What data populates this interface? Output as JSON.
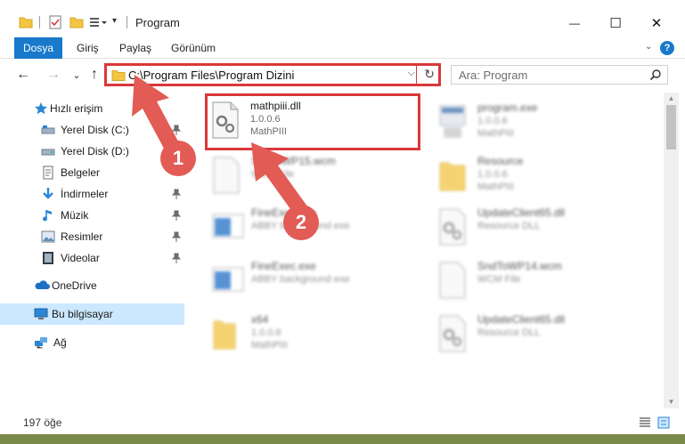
{
  "window": {
    "title": "Program",
    "minimize": "—",
    "maximize": "☐",
    "close": "✕"
  },
  "ribbon": {
    "tabs": [
      "Dosya",
      "Giriş",
      "Paylaş",
      "Görünüm"
    ],
    "help": "?"
  },
  "nav": {
    "back": "←",
    "forward": "→",
    "recent": "⌄",
    "up": "↑",
    "address": "C:\\Program Files\\Program Dizini",
    "address_dropdown": "⌵",
    "refresh": "↻",
    "search_placeholder": "Ara: Program"
  },
  "sidebar": {
    "items": [
      {
        "label": "Hızlı erişim",
        "icon": "star-icon"
      },
      {
        "label": "Yerel Disk (C:)",
        "icon": "drive-icon",
        "pinned": true
      },
      {
        "label": "Yerel Disk (D:)",
        "icon": "drive-icon"
      },
      {
        "label": "Belgeler",
        "icon": "documents-icon"
      },
      {
        "label": "İndirmeler",
        "icon": "download-icon",
        "pinned": true
      },
      {
        "label": "Müzik",
        "icon": "music-icon",
        "pinned": true
      },
      {
        "label": "Resimler",
        "icon": "pictures-icon",
        "pinned": true
      },
      {
        "label": "Videolar",
        "icon": "videos-icon",
        "pinned": true
      },
      {
        "label": "OneDrive",
        "icon": "cloud-icon"
      },
      {
        "label": "Bu bilgisayar",
        "icon": "computer-icon",
        "selected": true
      },
      {
        "label": "Ağ",
        "icon": "network-icon"
      }
    ]
  },
  "files": [
    {
      "name": "mathpiii.dll",
      "line2": "1.0.0.6",
      "line3": "MathPIII",
      "icon": "dll-gear-icon",
      "highlight": true
    },
    {
      "name": "program.exe",
      "line2": "1.0.0.6",
      "line3": "MathPIII",
      "icon": "exe-icon"
    },
    {
      "name": "SndToWP15.wcm",
      "line2": "WCM File",
      "line3": "",
      "icon": "file-icon"
    },
    {
      "name": "Resource",
      "line2": "1.0.0.6",
      "line3": "MathPIII",
      "icon": "folder-icon"
    },
    {
      "name": "FineExec.exe",
      "line2": "ABBY background exe",
      "line3": "",
      "icon": "app-window-icon"
    },
    {
      "name": "UpdateClient65.dll",
      "line2": "Resource DLL",
      "line3": "",
      "icon": "dll-gear-icon"
    },
    {
      "name": "FineExec.exe",
      "line2": "ABBY background exe",
      "line3": "",
      "icon": "app-window-icon"
    },
    {
      "name": "SndToWP14.wcm",
      "line2": "WCM File",
      "line3": "",
      "icon": "file-icon"
    },
    {
      "name": "x64",
      "line2": "1.0.0.6",
      "line3": "MathPIII",
      "icon": "folder-icon"
    },
    {
      "name": "UpdateClient65.dll",
      "line2": "Resource DLL",
      "line3": "",
      "icon": "dll-gear-icon"
    }
  ],
  "status": {
    "count": "197 öğe"
  },
  "annotations": {
    "step1": "1",
    "step2": "2",
    "accent": "#d9383a"
  },
  "colors": {
    "file_tab": "#1979ca",
    "selected": "#cce8ff"
  }
}
